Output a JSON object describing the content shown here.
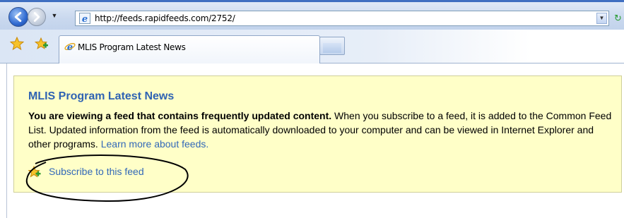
{
  "browser": {
    "address": {
      "url": "http://feeds.rapidfeeds.com/2752/"
    },
    "tabs": [
      {
        "label": "MLIS Program Latest News",
        "active": true
      }
    ],
    "icons": {
      "back": "back-arrow-icon",
      "forward": "forward-arrow-icon",
      "history_dropdown": "chevron-down-icon",
      "address_dropdown": "chevron-down-icon",
      "refresh": "refresh-icon",
      "favorites_center": "star-icon",
      "add_favorite": "star-plus-icon",
      "page_favicon": "internet-explorer-icon"
    },
    "colors": {
      "chrome_accent": "#3f6fc1",
      "link": "#3268b8",
      "feed_background": "#ffffc8"
    }
  },
  "feed": {
    "title": "MLIS Program Latest News",
    "intro_bold": "You are viewing a feed that contains frequently updated content.",
    "intro_text": " When you subscribe to a feed, it is added to the Common Feed List. Updated information from the feed is automatically downloaded to your computer and can be viewed in Internet Explorer and other programs. ",
    "learn_more": "Learn more about feeds.",
    "subscribe": "Subscribe to this feed"
  }
}
